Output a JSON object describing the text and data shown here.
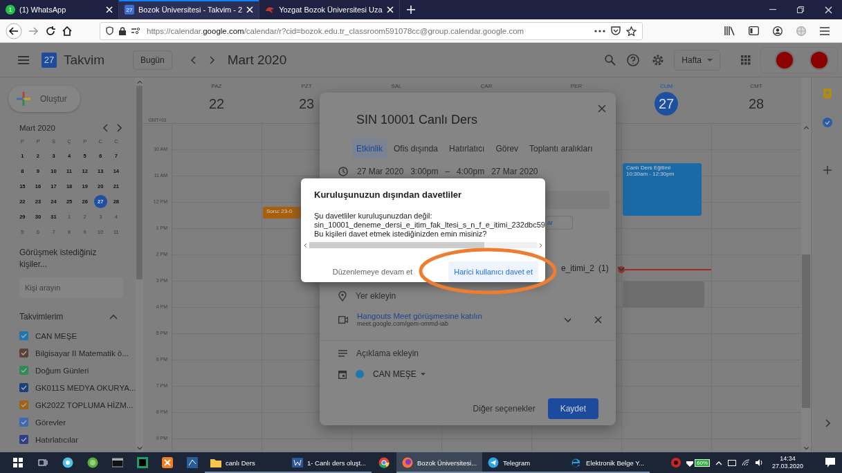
{
  "browser": {
    "tabs": [
      {
        "kind": "whatsapp",
        "badge": "1",
        "title": "(1) WhatsApp",
        "selected": false
      },
      {
        "kind": "calendar",
        "badge": "27",
        "title": "Bozok Üniversitesi - Takvim - 2",
        "selected": true
      },
      {
        "kind": "site",
        "title": "Yozgat Bozok Üniversitesi Uza",
        "selected": false
      }
    ],
    "url": "https://calendar.**google.com**/calendar/r?cid=bozok.edu.tr_classroom591078cc@group.calendar.google.com"
  },
  "calendar": {
    "header": {
      "logo_day": "27",
      "app_name": "Takvim",
      "today_button": "Bugün",
      "period": "Mart 2020",
      "view": "Hafta"
    },
    "create_button": "Oluştur",
    "mini_calendar": {
      "title": "Mart 2020",
      "weekdays": [
        "P",
        "P",
        "S",
        "Ç",
        "P",
        "C",
        "C"
      ],
      "weeks": [
        [
          {
            "day": "1",
            "outside": false,
            "selected": false
          },
          {
            "day": "2",
            "outside": false,
            "selected": false
          },
          {
            "day": "3",
            "outside": false,
            "selected": false
          },
          {
            "day": "4",
            "outside": false,
            "selected": false
          },
          {
            "day": "5",
            "outside": false,
            "selected": false
          },
          {
            "day": "6",
            "outside": false,
            "selected": false
          },
          {
            "day": "7",
            "outside": false,
            "selected": false
          }
        ],
        [
          {
            "day": "8",
            "outside": false,
            "selected": false
          },
          {
            "day": "9",
            "outside": false,
            "selected": false
          },
          {
            "day": "10",
            "outside": false,
            "selected": false
          },
          {
            "day": "11",
            "outside": false,
            "selected": false
          },
          {
            "day": "12",
            "outside": false,
            "selected": false
          },
          {
            "day": "13",
            "outside": false,
            "selected": false
          },
          {
            "day": "14",
            "outside": false,
            "selected": false
          }
        ],
        [
          {
            "day": "15",
            "outside": false,
            "selected": false
          },
          {
            "day": "16",
            "outside": false,
            "selected": false
          },
          {
            "day": "17",
            "outside": false,
            "selected": false
          },
          {
            "day": "18",
            "outside": false,
            "selected": false
          },
          {
            "day": "19",
            "outside": false,
            "selected": false
          },
          {
            "day": "20",
            "outside": false,
            "selected": false
          },
          {
            "day": "21",
            "outside": false,
            "selected": false
          }
        ],
        [
          {
            "day": "22",
            "outside": false,
            "selected": false
          },
          {
            "day": "23",
            "outside": false,
            "selected": false
          },
          {
            "day": "24",
            "outside": false,
            "selected": false
          },
          {
            "day": "25",
            "outside": false,
            "selected": false
          },
          {
            "day": "26",
            "outside": false,
            "selected": false
          },
          {
            "day": "27",
            "outside": false,
            "selected": true
          },
          {
            "day": "28",
            "outside": false,
            "selected": false
          }
        ],
        [
          {
            "day": "29",
            "outside": false,
            "selected": false
          },
          {
            "day": "30",
            "outside": false,
            "selected": false
          },
          {
            "day": "31",
            "outside": false,
            "selected": false
          },
          {
            "day": "1",
            "outside": true,
            "selected": false
          },
          {
            "day": "2",
            "outside": true,
            "selected": false
          },
          {
            "day": "3",
            "outside": true,
            "selected": false
          },
          {
            "day": "4",
            "outside": true,
            "selected": false
          }
        ],
        [
          {
            "day": "5",
            "outside": true,
            "selected": false
          },
          {
            "day": "6",
            "outside": true,
            "selected": false
          },
          {
            "day": "7",
            "outside": true,
            "selected": false
          },
          {
            "day": "8",
            "outside": true,
            "selected": false
          },
          {
            "day": "9",
            "outside": true,
            "selected": false
          },
          {
            "day": "10",
            "outside": true,
            "selected": false
          },
          {
            "day": "11",
            "outside": true,
            "selected": false
          }
        ]
      ]
    },
    "people_search": {
      "title": "Görüşmek istediğiniz kişiler...",
      "placeholder": "Kişi arayın"
    },
    "my_calendars": {
      "title": "Takvimlerim",
      "expanded": true,
      "items": [
        {
          "name": "CAN MEŞE",
          "color": "#1d78ad",
          "checked": true
        },
        {
          "name": "Bilgisayar II Matematik ö...",
          "color": "#5a423a",
          "checked": true
        },
        {
          "name": "Doğum Günleri",
          "color": "#2f8a56",
          "checked": true
        },
        {
          "name": "GK011S MEDYA OKURYA...",
          "color": "#1b3f7c",
          "checked": true
        },
        {
          "name": "GK202Z TOPLUMA HİZM...",
          "color": "#9c6414",
          "checked": true
        },
        {
          "name": "Görevler",
          "color": "#3d68b4",
          "checked": true
        },
        {
          "name": "Hatırlatıcılar",
          "color": "#2f3c88",
          "checked": true
        }
      ]
    },
    "timezone": "GMT+03",
    "hours": [
      "10 AM",
      "11 AM",
      "12 PM",
      "1 PM",
      "2 PM",
      "3 PM",
      "4 PM",
      "5 PM",
      "6 PM",
      "7 PM",
      "8 PM",
      "9 PM"
    ],
    "days": [
      {
        "weekday": "PAZ",
        "date": "22",
        "selected": false
      },
      {
        "weekday": "PZT",
        "date": "23",
        "selected": false,
        "events": [
          {
            "kind": "event",
            "title": "Soru: 23-0",
            "color": "#a8600c"
          }
        ]
      },
      {
        "weekday": "SAL",
        "selected": false
      },
      {
        "weekday": "ÇAR",
        "selected": false
      },
      {
        "weekday": "PER",
        "selected": false
      },
      {
        "weekday": "CUM",
        "date": "27",
        "selected": true,
        "events": [
          {
            "kind": "event",
            "title": "Canlı Ders Eğitimi",
            "time": "10:30am - 12:30pm",
            "color": "#1a6aa8"
          },
          {
            "kind": "draft"
          }
        ]
      },
      {
        "weekday": "CMT",
        "date": "28",
        "selected": false
      }
    ]
  },
  "event_dialog": {
    "title": "SIN 10001 Canlı Ders",
    "tabs": [
      {
        "label": "Etkinlik",
        "selected": true
      },
      {
        "label": "Ofis dışında",
        "selected": false
      },
      {
        "label": "Hatırlatıcı",
        "selected": false
      },
      {
        "label": "Görev",
        "selected": false
      },
      {
        "label": "Toplantı aralıkları",
        "selected": false
      }
    ],
    "date_row": [
      "27 Mar 2020",
      "3:00pm",
      "–",
      "4:00pm",
      "27 Mar 2020"
    ],
    "partial_button": "ar",
    "guest": {
      "name": "e_itimi_2",
      "count": "(1)"
    },
    "location_placeholder": "Yer ekleyin",
    "meet": {
      "link": "Hangouts Meet görüşmesine katılın",
      "url": "meet.google.com/gem-ommd-iab"
    },
    "description_placeholder": "Açıklama ekleyin",
    "calendar": {
      "name": "CAN MEŞE",
      "color": "#1d78ad"
    },
    "more_options": "Diğer seçenekler",
    "save": "Kaydet"
  },
  "modal": {
    "title": "Kuruluşunuzun dışından davetliler",
    "lines": [
      "Şu davetliler kuruluşunuzdan değil:",
      "sin_10001_deneme_dersi_e_itim_fak_ltesi_s_n_f_e_itimi_232dbc59",
      "Bu kişileri davet etmek istediğinizden emin misiniz?"
    ],
    "buttons": [
      {
        "label": "Düzenlemeye devam et",
        "kind": "secondary"
      },
      {
        "label": "Harici kullanıcı davet et",
        "kind": "primary"
      }
    ]
  },
  "taskbar": {
    "items": [
      {
        "kind": "start"
      },
      {
        "kind": "taskview"
      },
      {
        "kind": "chat"
      },
      {
        "kind": "globe"
      },
      {
        "kind": "terminal"
      },
      {
        "kind": "ws"
      },
      {
        "kind": "xampp"
      },
      {
        "kind": "diagram"
      },
      {
        "kind": "folder",
        "label": "canlı Ders",
        "selected": false
      },
      {
        "kind": "word",
        "label": "1- Canlı ders oluşt...",
        "selected": false
      },
      {
        "kind": "chrome"
      },
      {
        "kind": "firefox",
        "label": "Bozok Üniversitesi...",
        "selected": true
      },
      {
        "kind": "telegram",
        "label": "Telegram",
        "selected": false
      },
      {
        "kind": "ie",
        "label": "Elektronik Belge Y...",
        "selected": false
      }
    ],
    "battery": "60%",
    "time": "14:34",
    "date": "27.03.2020"
  }
}
